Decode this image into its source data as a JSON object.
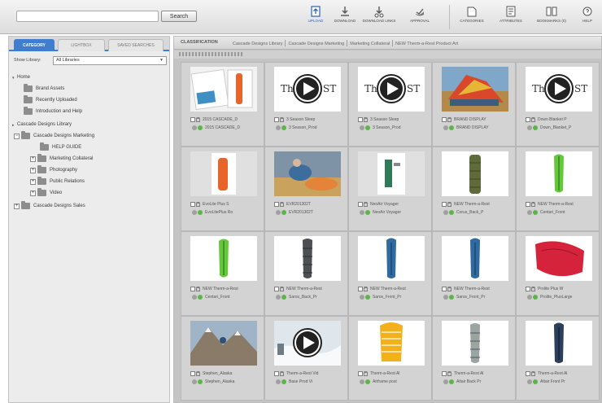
{
  "toolbar": {
    "search": {
      "value": "",
      "placeholder": ""
    },
    "search_button": "Search",
    "tools": [
      {
        "label": "UPLOAD",
        "icon": "upload-icon"
      },
      {
        "label": "DOWNLOAD",
        "icon": "download-icon"
      },
      {
        "label": "DOWNLOAD LINKS",
        "icon": "download-link-icon"
      },
      {
        "label": "APPROVAL",
        "icon": "approval-icon"
      },
      {
        "label": "CATEGORIES",
        "icon": "categories-icon"
      },
      {
        "label": "ATTRIBUTES",
        "icon": "attributes-icon"
      },
      {
        "label": "BOOKMARKS (0)",
        "icon": "bookmarks-icon"
      },
      {
        "label": "HELP",
        "icon": "help-icon"
      }
    ]
  },
  "left_panel": {
    "tabs": [
      "CATEGORY",
      "LIGHTBOX",
      "SAVED SEARCHES"
    ],
    "library_label": "Show Library:",
    "library_value": "All Libraries",
    "tree": [
      {
        "label": "Home"
      },
      {
        "label": "Brand Assets"
      },
      {
        "label": "Recently Uploaded"
      },
      {
        "label": "Introduction and Help"
      },
      {
        "label": "Cascade Designs Library"
      },
      {
        "label": "Cascade Designs Marketing"
      },
      {
        "label": "HELP GUIDE"
      },
      {
        "label": "Marketing Collateral"
      },
      {
        "label": "Photography"
      },
      {
        "label": "Public Relations"
      },
      {
        "label": "Video"
      },
      {
        "label": "Cascade Designs Sales"
      }
    ]
  },
  "content": {
    "crumb_title": "CLASSIFICATION",
    "breadcrumbs": [
      "Cascade Designs Library",
      "Cascade Designs Marketing",
      "Marketing Collateral",
      "NEW Therm-a-Rest Product Art"
    ],
    "items": [
      {
        "line1": "2015 CASCADE_D",
        "line2": "2015 CASCADE_D",
        "thumb": "brochure"
      },
      {
        "line1": "3 Season Sleep",
        "line2": "3 Season_Prod",
        "thumb": "video"
      },
      {
        "line1": "3 Season Sleep",
        "line2": "3 Season_Prod",
        "thumb": "video"
      },
      {
        "line1": "BRAND DISPLAY",
        "line2": "BRAND DISPLAY",
        "thumb": "display"
      },
      {
        "line1": "Down Blanket P",
        "line2": "Down_Blanket_P",
        "thumb": "video"
      },
      {
        "line1": "EvoLite Plus S",
        "line2": "EvoLitePlus Ro",
        "thumb": "orange"
      },
      {
        "line1": "EVR201302T",
        "line2": "EVR201302T",
        "thumb": "photo"
      },
      {
        "line1": "NeoAir Voyager",
        "line2": "NeoAir Voyager",
        "thumb": "green-mat"
      },
      {
        "line1": "NEW Therm-a-Rest",
        "line2": "Corus_Back_P",
        "thumb": "olive-bag"
      },
      {
        "line1": "NEW Therm-a-Rest",
        "line2": "Centari_Front",
        "thumb": "lime-bag"
      },
      {
        "line1": "NEW Therm-a-Rest",
        "line2": "Centari_Front",
        "thumb": "lime-bag"
      },
      {
        "line1": "NEW Therm-a-Rest",
        "line2": "Saros_Back_Pr",
        "thumb": "gray-bag"
      },
      {
        "line1": "NEW Therm-a-Rest",
        "line2": "Saros_Front_Pr",
        "thumb": "blue-bag"
      },
      {
        "line1": "NEW Therm-a-Rest",
        "line2": "Saros_Front_Pr",
        "thumb": "blue-bag"
      },
      {
        "line1": "Prolite Plus W",
        "line2": "Prolite_PlusLarge",
        "thumb": "red-mat"
      },
      {
        "line1": "Stephen_Alaska",
        "line2": "Stephen_Alaska",
        "thumb": "mountain"
      },
      {
        "line1": "Therm-a-Rest Vid",
        "line2": "Base Prod Vi",
        "thumb": "video-snow"
      },
      {
        "line1": "Therm-a-Rest Al",
        "line2": "Airframe post",
        "thumb": "yellow-bag"
      },
      {
        "line1": "Therm-a-Rest Al",
        "line2": "Altair Back Pr",
        "thumb": "gray-bag2"
      },
      {
        "line1": "Therm-a-Rest Al",
        "line2": "Altair Front Pr",
        "thumb": "navy-bag"
      }
    ]
  }
}
